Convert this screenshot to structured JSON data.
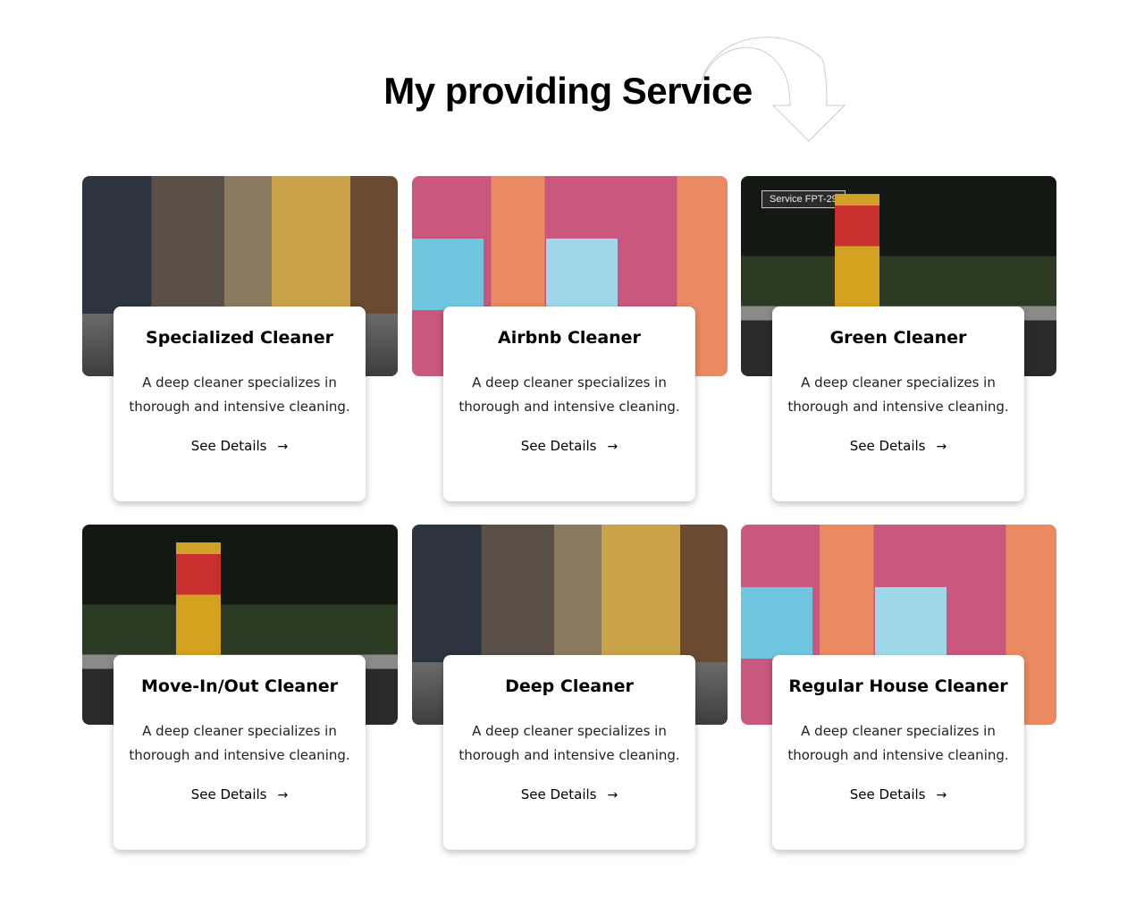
{
  "header": {
    "title": "My providing Service"
  },
  "tooltip": "Service FPT-29",
  "cards": [
    {
      "title": "Specialized Cleaner",
      "desc": "A deep cleaner specializes in thorough and intensive cleaning.",
      "link": "See Details",
      "image": "cloister"
    },
    {
      "title": "Airbnb Cleaner",
      "desc": "A deep cleaner specializes in thorough and intensive cleaning.",
      "link": "See Details",
      "image": "pink"
    },
    {
      "title": "Green Cleaner",
      "desc": "A deep cleaner specializes in thorough and intensive cleaning.",
      "link": "See Details",
      "image": "park"
    },
    {
      "title": "Move-In/Out Cleaner",
      "desc": "A deep cleaner specializes in thorough and intensive cleaning.",
      "link": "See Details",
      "image": "park"
    },
    {
      "title": "Deep Cleaner",
      "desc": "A deep cleaner specializes in thorough and intensive cleaning.",
      "link": "See Details",
      "image": "cloister"
    },
    {
      "title": "Regular House Cleaner",
      "desc": "A deep cleaner specializes in thorough and intensive cleaning.",
      "link": "See Details",
      "image": "pink"
    }
  ],
  "icons": {
    "arrow": "arrow-right-icon",
    "decor": "curved-arrow-down-icon"
  }
}
